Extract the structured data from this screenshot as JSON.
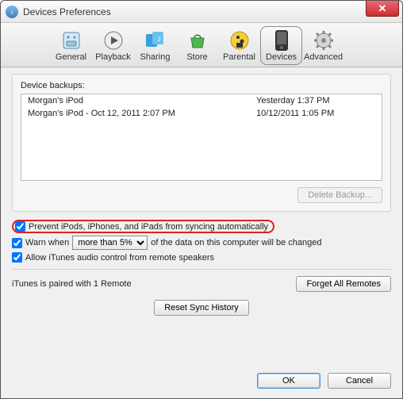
{
  "window": {
    "title": "Devices Preferences"
  },
  "toolbar": {
    "tabs": [
      {
        "label": "General",
        "name": "tab-general"
      },
      {
        "label": "Playback",
        "name": "tab-playback"
      },
      {
        "label": "Sharing",
        "name": "tab-sharing"
      },
      {
        "label": "Store",
        "name": "tab-store"
      },
      {
        "label": "Parental",
        "name": "tab-parental"
      },
      {
        "label": "Devices",
        "name": "tab-devices",
        "selected": true
      },
      {
        "label": "Advanced",
        "name": "tab-advanced"
      }
    ]
  },
  "backups": {
    "heading": "Device backups:",
    "rows": [
      {
        "name": "Morgan's iPod",
        "date": "Yesterday 1:37 PM"
      },
      {
        "name": "Morgan's iPod - Oct 12, 2011 2:07 PM",
        "date": "10/12/2011 1:05 PM"
      }
    ],
    "delete_label": "Delete Backup..."
  },
  "options": {
    "prevent_sync": {
      "checked": true,
      "label": "Prevent iPods, iPhones, and iPads from syncing automatically"
    },
    "warn": {
      "checked": true,
      "prefix": "Warn when",
      "select_value": "more than 5%",
      "options": [
        "more than 5%"
      ],
      "suffix": "of the data on this computer will be changed"
    },
    "remote_audio": {
      "checked": true,
      "label": "Allow iTunes audio control from remote speakers"
    }
  },
  "remotes": {
    "status": "iTunes is paired with 1 Remote",
    "forget_label": "Forget All Remotes"
  },
  "reset_sync_label": "Reset Sync History",
  "footer": {
    "ok": "OK",
    "cancel": "Cancel"
  }
}
